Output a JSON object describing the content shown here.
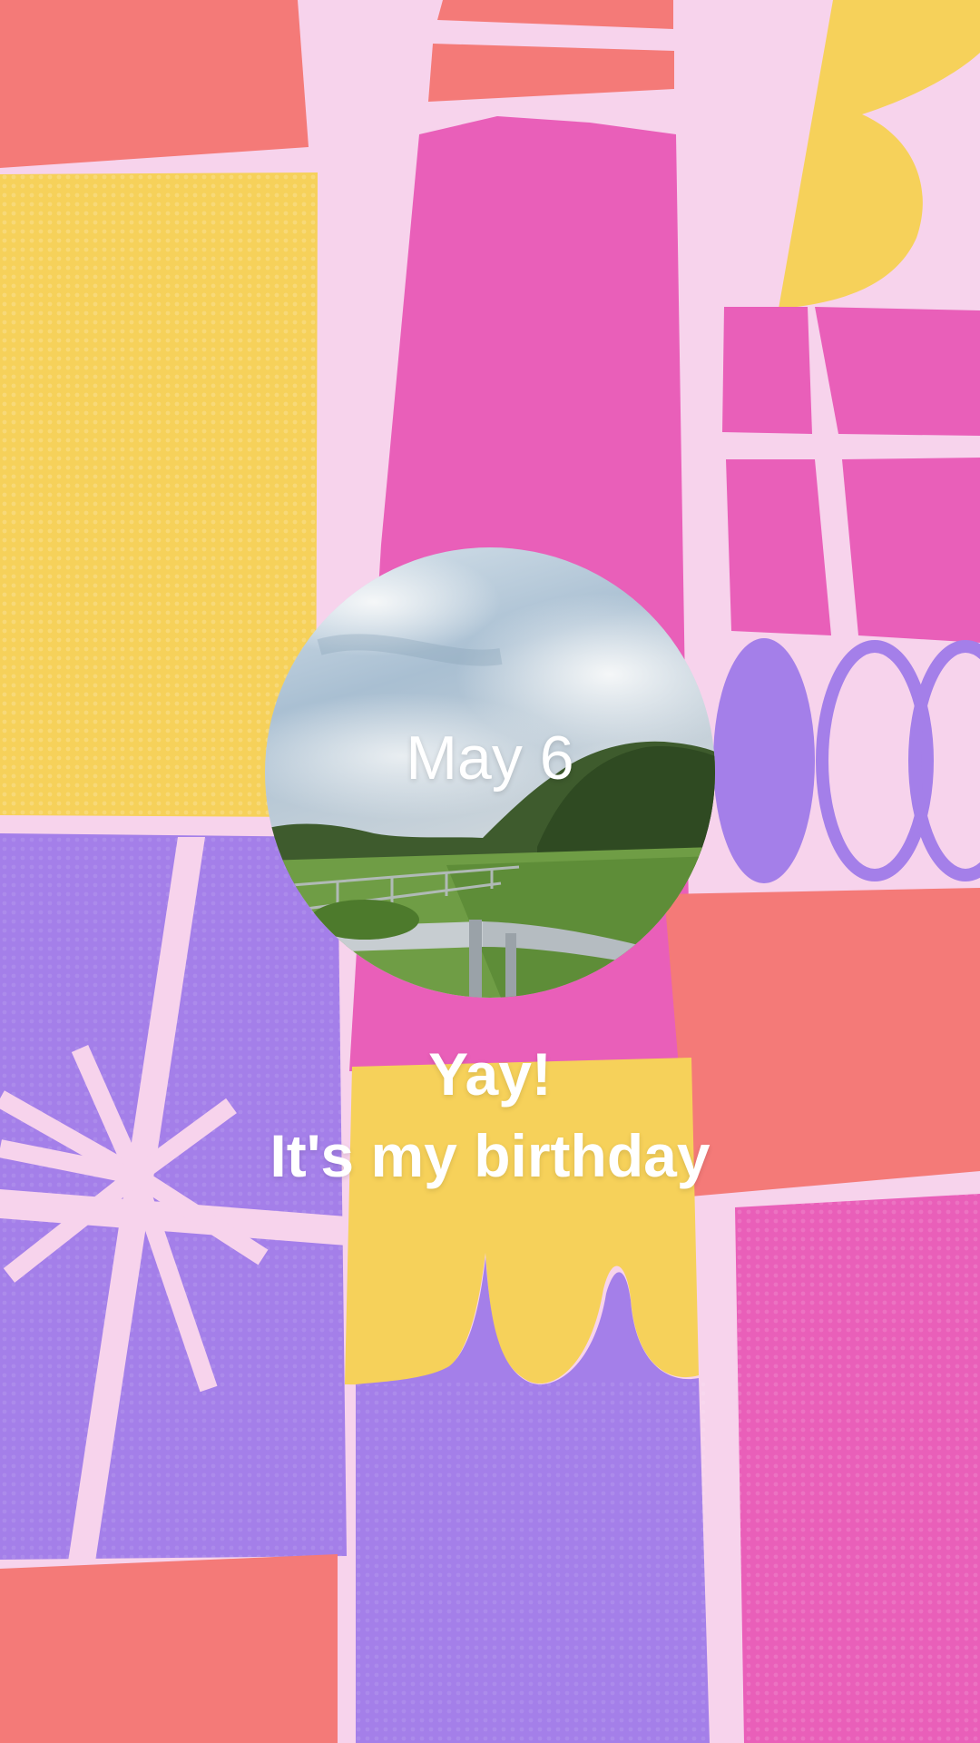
{
  "story": {
    "date": "May 6",
    "line1": "Yay!",
    "line2": "It's my birthday"
  },
  "photo": {
    "subject": "sky-field-fence-photo"
  },
  "colors": {
    "background": "#f7d3ec",
    "coral": "#f47a78",
    "yellow": "#f6d15a",
    "magenta": "#e95fb9",
    "purple": "#a47fe9",
    "text": "#ffffff"
  }
}
